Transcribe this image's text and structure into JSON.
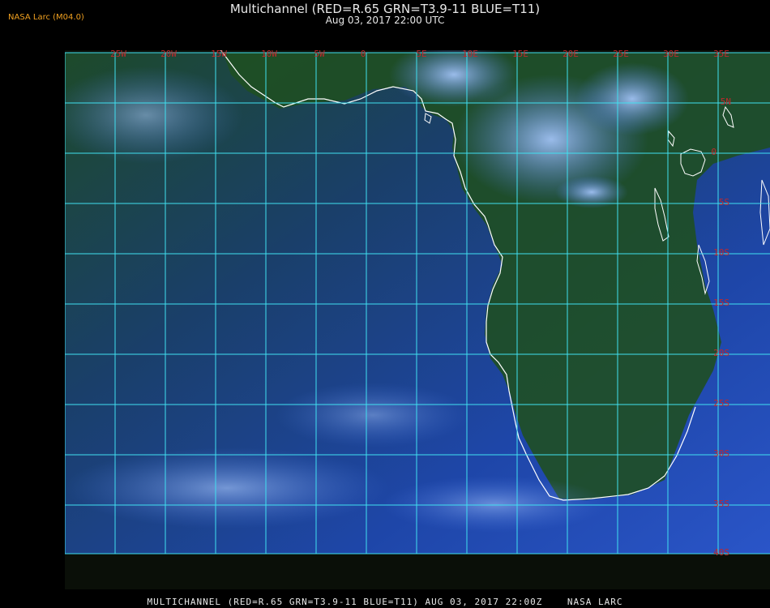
{
  "header": {
    "badge": "NASA Larc (M04.0)",
    "title": "Multichannel (RED=R.65 GRN=T3.9-11 BLUE=T11)",
    "subtitle": "Aug 03, 2017 22:00 UTC"
  },
  "footer": {
    "text": "MULTICHANNEL (RED=R.65 GRN=T3.9-11 BLUE=T11) AUG 03, 2017 22:00Z    NASA LARC"
  },
  "map": {
    "longitude_labels": [
      "25W",
      "20W",
      "15W",
      "10W",
      "5W",
      "0",
      "5E",
      "10E",
      "15E",
      "20E",
      "25E",
      "30E",
      "35E"
    ],
    "latitude_labels": [
      "5N",
      "0",
      "5S",
      "10S",
      "15S",
      "20S",
      "25S",
      "30S",
      "35S",
      "40S"
    ],
    "colors": {
      "grid": "#40e0f0",
      "coastline": "#ffffff",
      "labels": "#c0282c",
      "ocean": "#1e3a8a",
      "land": "#1f4a20",
      "cloud": "#5b8ff0"
    }
  }
}
